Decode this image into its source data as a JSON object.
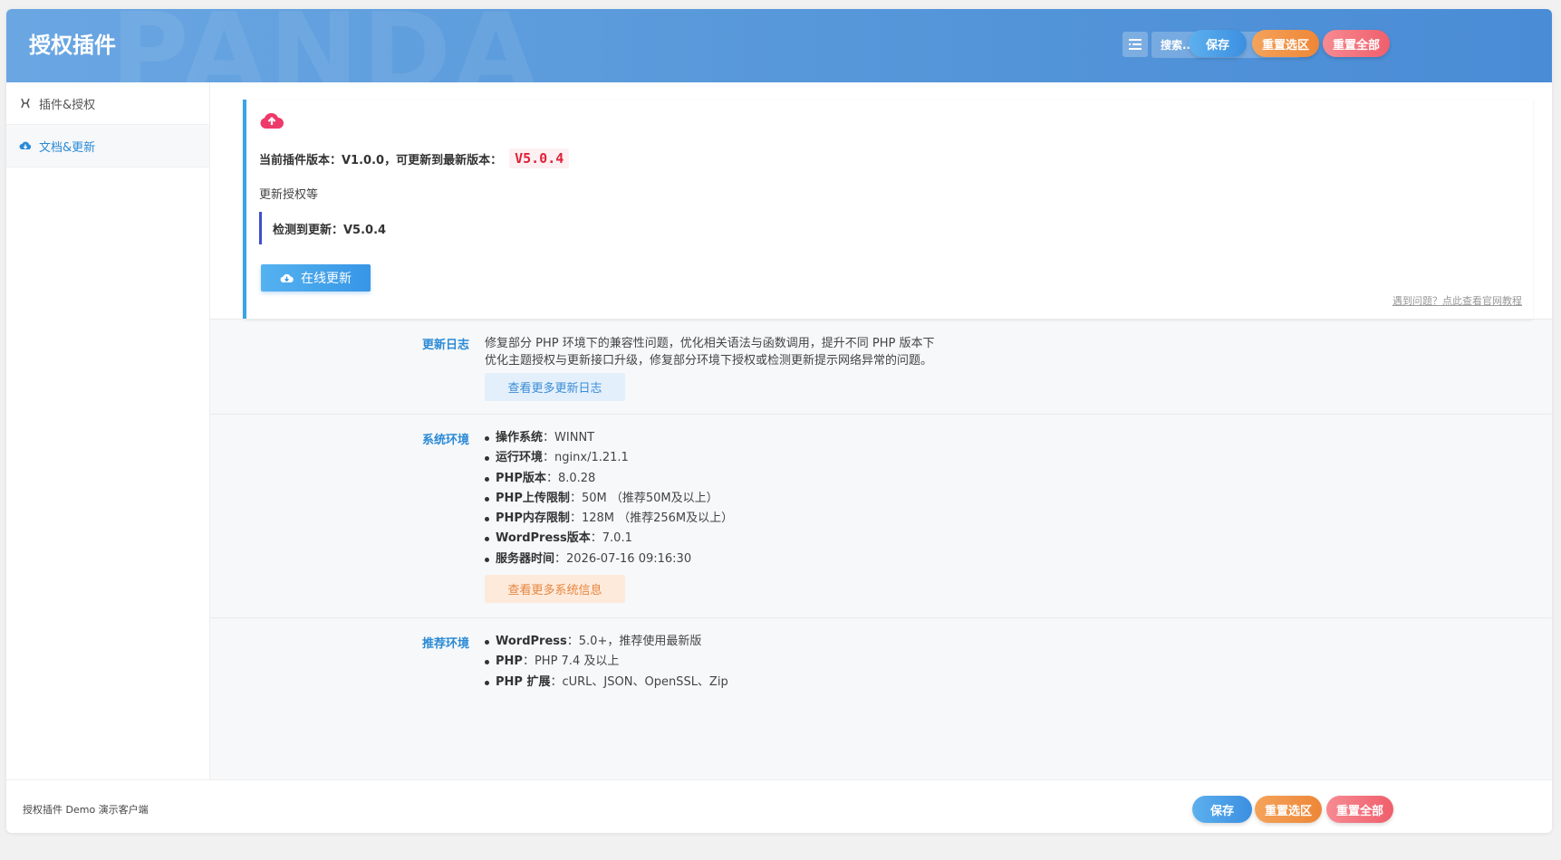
{
  "header": {
    "title": "授权插件",
    "watermark": "PANDA",
    "search_placeholder": "搜索...",
    "save_label": "保存",
    "reset_section_label": "重置选区",
    "reset_all_label": "重置全部"
  },
  "sidebar": {
    "items": [
      {
        "label": "插件&授权",
        "icon": "plugin-icon",
        "active": false
      },
      {
        "label": "文档&更新",
        "icon": "cloud-download-icon",
        "active": true
      }
    ]
  },
  "update_card": {
    "current_version_text": "当前插件版本：V1.0.0，可更新到最新版本：",
    "latest_version": "V5.0.4",
    "description": "更新授权等",
    "detected_text": "检测到更新：V5.0.4",
    "update_button": "在线更新",
    "help_link": "遇到问题？点此查看官网教程",
    "accent_color": "#3ba3e6",
    "icon_color": "#ee3a6a"
  },
  "changelog": {
    "label": "更新日志",
    "lines": [
      "修复部分 PHP 环境下的兼容性问题，优化相关语法与函数调用，提升不同 PHP 版本下",
      "优化主题授权与更新接口升级，修复部分环境下授权或检测更新提示网络异常的问题。"
    ],
    "more_button": "查看更多更新日志"
  },
  "system_env": {
    "label": "系统环境",
    "items": [
      {
        "key": "操作系统",
        "value": "WINNT"
      },
      {
        "key": "运行环境",
        "value": "nginx/1.21.1"
      },
      {
        "key": "PHP版本",
        "value": "8.0.28"
      },
      {
        "key": "PHP上传限制",
        "value": "50M （推荐50M及以上）"
      },
      {
        "key": "PHP内存限制",
        "value": "128M （推荐256M及以上）"
      },
      {
        "key": "WordPress版本",
        "value": "7.0.1"
      },
      {
        "key": "服务器时间",
        "value": "2026-07-16 09:16:30"
      }
    ],
    "more_button": "查看更多系统信息"
  },
  "recommended_env": {
    "label": "推荐环境",
    "items": [
      {
        "key": "WordPress",
        "value": "5.0+，推荐使用最新版"
      },
      {
        "key": "PHP",
        "value": "PHP 7.4 及以上"
      },
      {
        "key": "PHP 扩展",
        "value": "cURL、JSON、OpenSSL、Zip"
      }
    ]
  },
  "footer": {
    "text": "授权插件 Demo 演示客户端",
    "save_label": "保存",
    "reset_section_label": "重置选区",
    "reset_all_label": "重置全部"
  }
}
